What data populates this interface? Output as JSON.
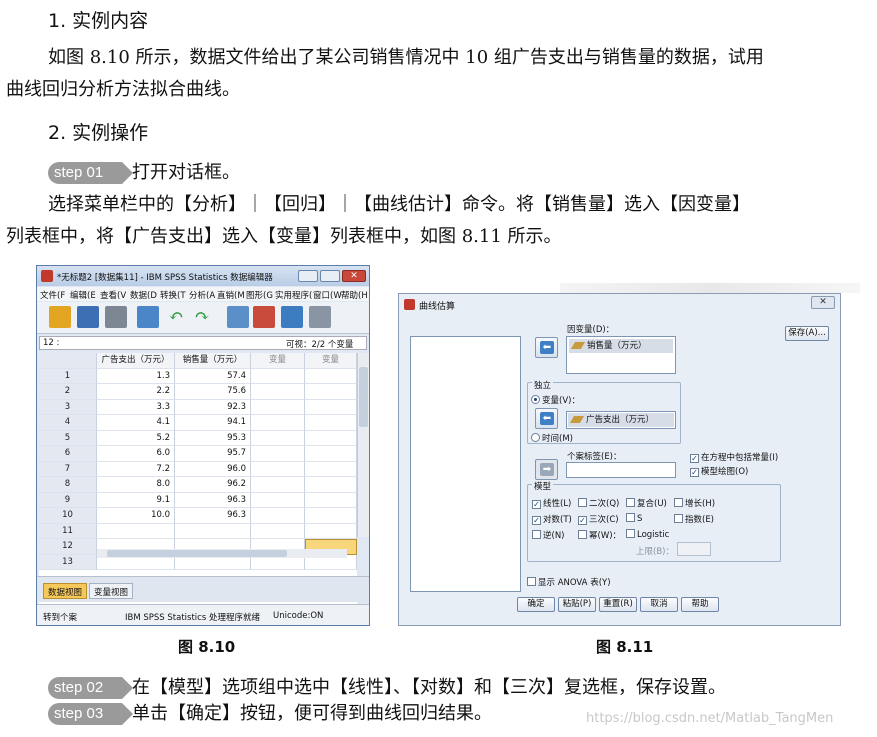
{
  "section1": {
    "heading": "1. 实例内容",
    "para_line1": "如图 8.10 所示，数据文件给出了某公司销售情况中 10 组广告支出与销售量的数据，试用",
    "para_line2": "曲线回归分析方法拟合曲线。"
  },
  "section2": {
    "heading": "2. 实例操作"
  },
  "step01": {
    "badge": "step 01",
    "text": "打开对话框。"
  },
  "step01_body": {
    "line1": "选择菜单栏中的【分析】｜【回归】｜【曲线估计】命令。将【销售量】选入【因变量】",
    "line2": "列表框中，将【广告支出】选入【变量】列表框中，如图 8.11 所示。"
  },
  "spss": {
    "title": "*无标题2 [数据集11] - IBM SPSS Statistics 数据编辑器",
    "menu": [
      "文件(F",
      "编辑(E",
      "查看(V",
      "数据(D",
      "转换(T",
      "分析(A",
      "直销(M",
      "图形(G",
      "实用程序(",
      "窗口(W",
      "帮助(H"
    ],
    "cell_ref": "12 :",
    "visible": "可视：2/2 个变量",
    "columns": [
      "广告支出（万元）",
      "销售量（万元）",
      "变量",
      "变量"
    ],
    "rows": [
      {
        "n": "1",
        "a": "1.3",
        "b": "57.4"
      },
      {
        "n": "2",
        "a": "2.2",
        "b": "75.6"
      },
      {
        "n": "3",
        "a": "3.3",
        "b": "92.3"
      },
      {
        "n": "4",
        "a": "4.1",
        "b": "94.1"
      },
      {
        "n": "5",
        "a": "5.2",
        "b": "95.3"
      },
      {
        "n": "6",
        "a": "6.0",
        "b": "95.7"
      },
      {
        "n": "7",
        "a": "7.2",
        "b": "96.0"
      },
      {
        "n": "8",
        "a": "8.0",
        "b": "96.2"
      },
      {
        "n": "9",
        "a": "9.1",
        "b": "96.3"
      },
      {
        "n": "10",
        "a": "10.0",
        "b": "96.3"
      },
      {
        "n": "11",
        "a": "",
        "b": ""
      },
      {
        "n": "12",
        "a": "",
        "b": ""
      },
      {
        "n": "13",
        "a": "",
        "b": ""
      }
    ],
    "tab_data": "数据视图",
    "tab_var": "变量视图",
    "status_left": "转到个案",
    "status_mid": "IBM SPSS Statistics 处理程序就绪",
    "status_right": "Unicode:ON"
  },
  "dialog": {
    "title": "曲线估算",
    "dep_label": "因变量(D)：",
    "dep_item": "销售量（万元）",
    "indep_label": "独立",
    "var_radio": "变量(V)：",
    "var_item": "广告支出（万元）",
    "time_radio": "时间(M)",
    "case_label": "个案标签(E)：",
    "include_const": "在方程中包括常量(I)",
    "plot_models": "模型绘图(O)",
    "save_btn": "保存(A)...",
    "models_label": "模型",
    "models": [
      {
        "label": "线性(L)",
        "checked": "✓"
      },
      {
        "label": "二次(Q)",
        "checked": ""
      },
      {
        "label": "复合(U)",
        "checked": ""
      },
      {
        "label": "增长(H)",
        "checked": ""
      },
      {
        "label": "对数(T)",
        "checked": "✓"
      },
      {
        "label": "三次(C)",
        "checked": "✓"
      },
      {
        "label": "S",
        "checked": ""
      },
      {
        "label": "指数(E)",
        "checked": ""
      },
      {
        "label": "逆(N)",
        "checked": ""
      },
      {
        "label": "幂(W)：",
        "checked": ""
      },
      {
        "label": "Logistic",
        "checked": ""
      }
    ],
    "upper_label": "上限(B)：",
    "anova": "显示 ANOVA 表(Y)",
    "buttons": {
      "ok": "确定",
      "paste": "粘贴(P)",
      "reset": "重置(R)",
      "cancel": "取消",
      "help": "帮助"
    }
  },
  "captions": {
    "fig810": "图 8.10",
    "fig811": "图 8.11"
  },
  "step02": {
    "badge": "step 02",
    "text": "在【模型】选项组中选中【线性】、【对数】和【三次】复选框，保存设置。"
  },
  "step03": {
    "badge": "step 03",
    "text": "单击【确定】按钮，便可得到曲线回归结果。"
  },
  "watermark": "https://blog.csdn.net/Matlab_TangMen"
}
